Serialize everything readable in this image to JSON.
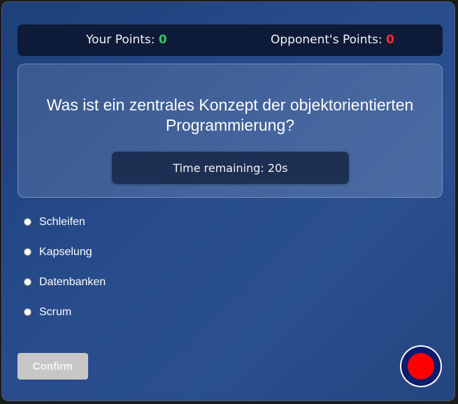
{
  "scoreboard": {
    "your_points_label": "Your Points: ",
    "your_points_value": "0",
    "opponent_points_label": "Opponent's Points: ",
    "opponent_points_value": "0"
  },
  "question": {
    "text": "Was ist ein zentrales Konzept der objektorientierten Programmierung?",
    "timer_text": "Time remaining: 20s"
  },
  "options": [
    {
      "label": "Schleifen",
      "selected": false
    },
    {
      "label": "Kapselung",
      "selected": false
    },
    {
      "label": "Datenbanken",
      "selected": false
    },
    {
      "label": "Scrum",
      "selected": false
    }
  ],
  "actions": {
    "confirm_label": "Confirm",
    "confirm_disabled": true
  },
  "icons": {
    "record": "record-icon"
  },
  "colors": {
    "your_points": "#39c26b",
    "opponent_points": "#ff2b2b",
    "record_dot": "#ff0000"
  }
}
